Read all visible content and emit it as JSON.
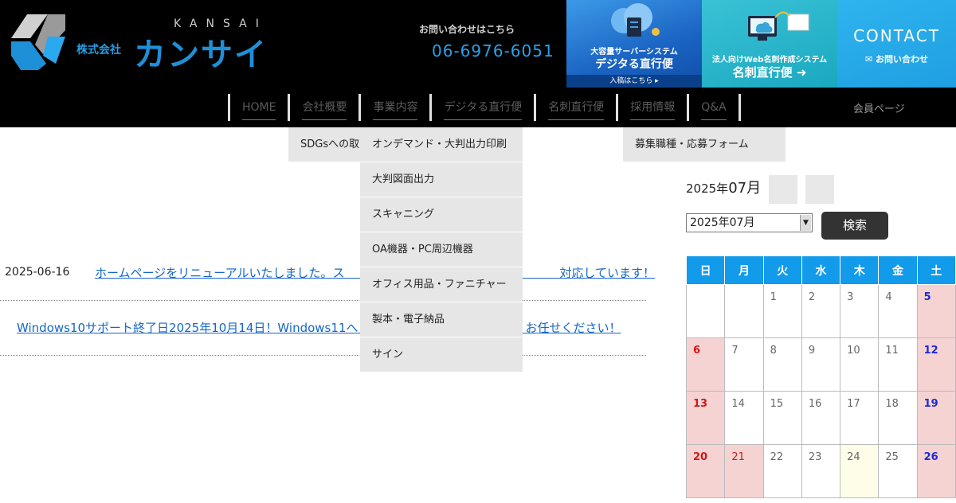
{
  "header": {
    "logo_romaji": "KANSAI",
    "logo_kk": "株式会社",
    "logo_name": "カンサイ",
    "contact_label": "お問い合わせはこちら",
    "contact_phone": "06-6976-6051"
  },
  "banners": [
    {
      "sub": "大容量サーバーシステム",
      "main": "デジタる直行便",
      "strip": "入稿はこちら ▸"
    },
    {
      "sub": "法人向けWeb名刺作成システム",
      "main": "名刺直行便 ➜"
    },
    {
      "title": "CONTACT",
      "sub": "✉ お問い合わせ"
    }
  ],
  "nav": {
    "items": [
      "HOME",
      "会社概要",
      "事業内容",
      "デジタる直行便",
      "名刺直行便",
      "採用情報",
      "Q&A"
    ],
    "member": "会員ページ"
  },
  "dropdowns": {
    "company": [
      "SDGsへの取"
    ],
    "business": [
      "オンデマンド・大判出力印刷",
      "大判図面出力",
      "スキャニング",
      "OA機器・PC周辺機器",
      "オフィス用品・ファニチャー",
      "製本・電子納品",
      "サイン"
    ],
    "recruit": [
      "募集職種・応募フォーム"
    ]
  },
  "news": [
    {
      "date": "2025-06-16",
      "title": "ホームページをリニューアルいたしました。ス　　　　　　　　　　　　　　　　　　対応しています！"
    },
    {
      "date": "",
      "title": "Windows10サポート終了日2025年10月14日！Windows11へ　　　　　　　　　　　　　　お任せください！"
    }
  ],
  "calendar": {
    "year_label": "2025年",
    "month_label": "07月",
    "select_value": "2025年07月",
    "search_label": "検索",
    "weekdays": [
      "日",
      "月",
      "火",
      "水",
      "木",
      "金",
      "土"
    ],
    "weeks": [
      [
        "",
        "",
        "1",
        "2",
        "3",
        "4",
        "5"
      ],
      [
        "6",
        "7",
        "8",
        "9",
        "10",
        "11",
        "12"
      ],
      [
        "13",
        "14",
        "15",
        "16",
        "17",
        "18",
        "19"
      ],
      [
        "20",
        "21",
        "22",
        "23",
        "24",
        "25",
        "26"
      ]
    ],
    "holiday": "21",
    "today": "24"
  },
  "colors": {
    "accent": "#119bea",
    "header_bg": "#000000",
    "holiday_bg": "#f6d3d3",
    "link": "#1466c8"
  }
}
